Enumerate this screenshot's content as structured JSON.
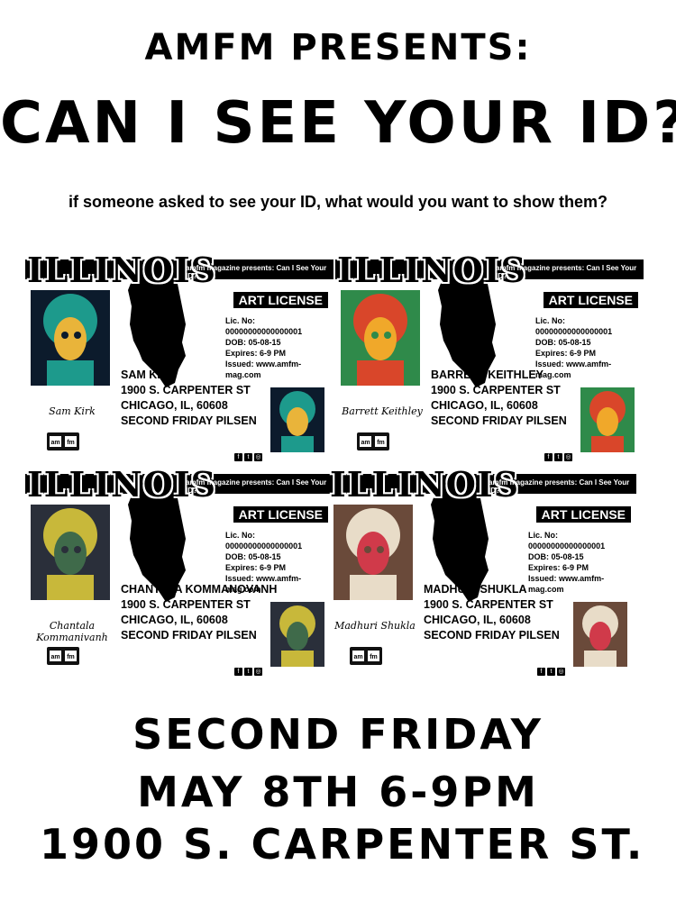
{
  "header": {
    "top_line": "AMFM PRESENTS:",
    "title": "CAN I SEE YOUR ID?",
    "tagline": "if someone asked  to see your ID,  what would you want to show them?"
  },
  "cards": [
    {
      "state": "ILLINOIS",
      "presents": "amfm magazine presents: Can I See Your ID?",
      "license_label": "ART LICENSE",
      "lic_no": "Lic. No: 00000000000000001",
      "dob": "DOB: 05-08-15",
      "expires": "Expires: 6-9 PM",
      "issued": "Issued: www.amfm-mag.com",
      "name": "SAM KIRK",
      "address1": "1900 S. CARPENTER ST",
      "address2": "CHICAGO, IL, 60608",
      "address3": "SECOND FRIDAY PILSEN",
      "signature": "Sam Kirk",
      "logo_left": "am",
      "logo_right": "fm",
      "portrait_colors": [
        "#1d9a8c",
        "#e9b43a",
        "#0c1b2c"
      ]
    },
    {
      "state": "ILLINOIS",
      "presents": "amfm magazine presents: Can I See Your ID?",
      "license_label": "ART LICENSE",
      "lic_no": "Lic. No: 00000000000000001",
      "dob": "DOB: 05-08-15",
      "expires": "Expires: 6-9 PM",
      "issued": "Issued: www.amfm-mag.com",
      "name": "BARRETT KEITHLEY",
      "address1": "1900 S. CARPENTER ST",
      "address2": "CHICAGO, IL, 60608",
      "address3": "SECOND FRIDAY PILSEN",
      "signature": "Barrett Keithley",
      "logo_left": "am",
      "logo_right": "fm",
      "portrait_colors": [
        "#d9462a",
        "#f0a82a",
        "#2f8a4a"
      ]
    },
    {
      "state": "ILLINOIS",
      "presents": "amfm magazine presents: Can I See Your ID?",
      "license_label": "ART LICENSE",
      "lic_no": "Lic. No: 00000000000000001",
      "dob": "DOB: 05-08-15",
      "expires": "Expires: 6-9 PM",
      "issued": "Issued: www.amfm-mag.com",
      "name": "CHANTALA KOMMANOVANH",
      "address1": "1900 S. CARPENTER ST",
      "address2": "CHICAGO, IL, 60608",
      "address3": "SECOND FRIDAY PILSEN",
      "signature": "Chantala Kommanivanh",
      "logo_left": "am",
      "logo_right": "fm",
      "portrait_colors": [
        "#c8b83a",
        "#3f6a4a",
        "#2a2f3a"
      ]
    },
    {
      "state": "ILLINOIS",
      "presents": "amfm magazine presents: Can I See Your ID?",
      "license_label": "ART LICENSE",
      "lic_no": "Lic. No: 00000000000000001",
      "dob": "DOB: 05-08-15",
      "expires": "Expires: 6-9 PM",
      "issued": "Issued: www.amfm-mag.com",
      "name": "MADHURI SHUKLA",
      "address1": "1900 S. CARPENTER ST",
      "address2": "CHICAGO, IL, 60608",
      "address3": "SECOND FRIDAY PILSEN",
      "signature": "Madhuri Shukla",
      "logo_left": "am",
      "logo_right": "fm",
      "portrait_colors": [
        "#e8dcc8",
        "#d03a4a",
        "#6a4a3a"
      ]
    }
  ],
  "footer": {
    "line1": "SECOND FRIDAY",
    "line2": "MAY 8TH 6-9PM",
    "line3": "1900 S. CARPENTER ST."
  },
  "social_icons": [
    "facebook-icon",
    "twitter-icon",
    "instagram-icon"
  ]
}
